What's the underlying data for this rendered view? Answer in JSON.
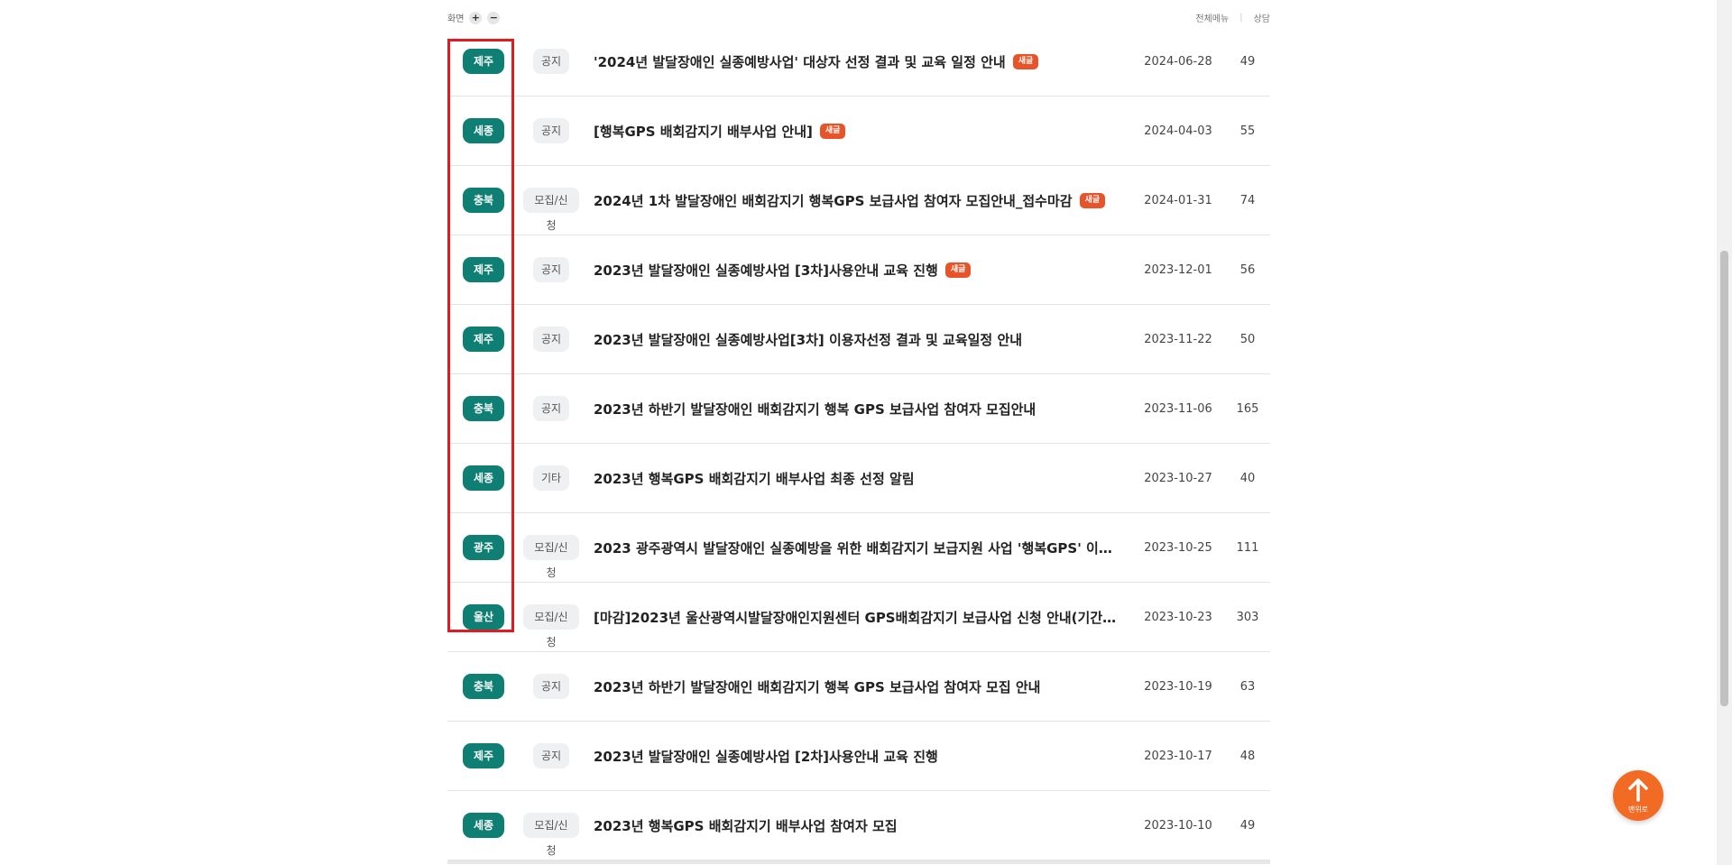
{
  "topbar": {
    "zoom_label": "화면",
    "zoom_in": "+",
    "zoom_out": "−",
    "all_menu": "전체메뉴",
    "consult": "상담"
  },
  "rows": [
    {
      "region": "제주",
      "category": "공지",
      "title": "'2024년 발달장애인 실종예방사업' 대상자 선정 결과 및 교육 일정 안내",
      "is_new": true,
      "date": "2024-06-28",
      "views": "49"
    },
    {
      "region": "세종",
      "category": "공지",
      "title": "[행복GPS 배회감지기 배부사업 안내]",
      "is_new": true,
      "date": "2024-04-03",
      "views": "55"
    },
    {
      "region": "충북",
      "category": "모집/신청",
      "title": "2024년 1차 발달장애인 배회감지기 행복GPS 보급사업 참여자 모집안내_접수마감",
      "is_new": true,
      "date": "2024-01-31",
      "views": "74"
    },
    {
      "region": "제주",
      "category": "공지",
      "title": "2023년 발달장애인 실종예방사업 [3차]사용안내 교육 진행",
      "is_new": true,
      "date": "2023-12-01",
      "views": "56"
    },
    {
      "region": "제주",
      "category": "공지",
      "title": "2023년 발달장애인 실종예방사업[3차] 이용자선정 결과 및 교육일정 안내",
      "is_new": false,
      "date": "2023-11-22",
      "views": "50"
    },
    {
      "region": "충북",
      "category": "공지",
      "title": "2023년 하반기 발달장애인 배회감지기 행복 GPS 보급사업 참여자 모집안내",
      "is_new": false,
      "date": "2023-11-06",
      "views": "165"
    },
    {
      "region": "세종",
      "category": "기타",
      "title": "2023년 행복GPS 배회감지기 배부사업 최종 선정 알림",
      "is_new": false,
      "date": "2023-10-27",
      "views": "40"
    },
    {
      "region": "광주",
      "category": "모집/신청",
      "title": "2023 광주광역시 발달장애인 실종예방을 위한 배회감지기 보급지원 사업 '행복GPS' 이용…",
      "is_new": false,
      "date": "2023-10-25",
      "views": "111"
    },
    {
      "region": "울산",
      "category": "모집/신청",
      "title": "[마감]2023년 울산광역시발달장애인지원센터 GPS배회감지기 보급사업 신청 안내(기간연…",
      "is_new": false,
      "date": "2023-10-23",
      "views": "303"
    },
    {
      "region": "충북",
      "category": "공지",
      "title": "2023년 하반기 발달장애인 배회감지기 행복 GPS 보급사업 참여자 모집 안내",
      "is_new": false,
      "date": "2023-10-19",
      "views": "63"
    },
    {
      "region": "제주",
      "category": "공지",
      "title": "2023년 발달장애인 실종예방사업 [2차]사용안내 교육 진행",
      "is_new": false,
      "date": "2023-10-17",
      "views": "48"
    },
    {
      "region": "세종",
      "category": "모집/신청",
      "title": "2023년 행복GPS 배회감지기 배부사업 참여자 모집",
      "is_new": false,
      "date": "2023-10-10",
      "views": "49"
    }
  ],
  "new_badge_label": "새글",
  "top_button_label": "맨위로",
  "colors": {
    "region_badge": "#0e7f72",
    "new_badge": "#e8542a",
    "highlight_box": "#e01b22",
    "top_button": "#f26b24"
  }
}
